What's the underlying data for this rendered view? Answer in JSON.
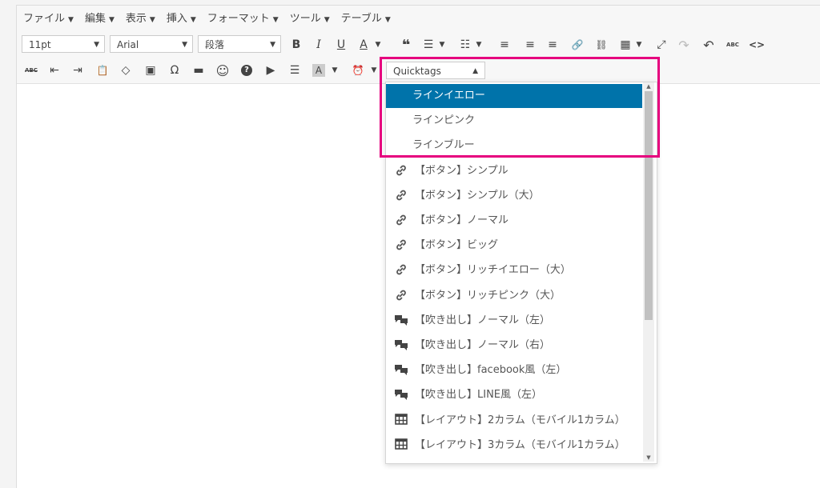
{
  "menubar": [
    {
      "label": "ファイル",
      "caret": "▼"
    },
    {
      "label": "編集",
      "caret": "▼"
    },
    {
      "label": "表示",
      "caret": "▼"
    },
    {
      "label": "挿入",
      "caret": "▼"
    },
    {
      "label": "フォーマット",
      "caret": "▼"
    },
    {
      "label": "ツール",
      "caret": "▼"
    },
    {
      "label": "テーブル",
      "caret": "▼"
    }
  ],
  "toolbar": {
    "font_size": "11pt",
    "font_family": "Arial",
    "format": "段落",
    "bold": "B",
    "italic": "I",
    "underline": "U",
    "text_color": "A",
    "blockquote": "❝",
    "bullet_list": "☰",
    "numbered_list": "☷",
    "align_left": "≡",
    "align_center": "≡",
    "align_right": "≡",
    "link": "🔗",
    "unlink": "⛓",
    "table": "▦",
    "fullscreen": "⤢",
    "redo": "↷",
    "undo": "↶",
    "spellcheck": "ABC",
    "code": "<>",
    "strikethrough": "ABC",
    "outdent": "⇤",
    "indent": "⇥",
    "paste": "📋",
    "clear_format": "◇",
    "image": "▣",
    "omega": "Ω",
    "hr": "▬",
    "emoji": "☺",
    "help": "?",
    "media": "▶",
    "justify": "☰",
    "bg_color": "A",
    "clock": "⏰",
    "dropdown_caret": "▼"
  },
  "quicktags": {
    "label": "Quicktags",
    "caret": "▲"
  },
  "dropdown": {
    "items": [
      {
        "label": "ラインイエロー",
        "icon": "",
        "selected": true
      },
      {
        "label": "ラインピンク",
        "icon": ""
      },
      {
        "label": "ラインブルー",
        "icon": ""
      },
      {
        "label": "【ボタン】シンプル",
        "icon": "link-icon"
      },
      {
        "label": "【ボタン】シンプル（大）",
        "icon": "link-icon"
      },
      {
        "label": "【ボタン】ノーマル",
        "icon": "link-icon"
      },
      {
        "label": "【ボタン】ビッグ",
        "icon": "link-icon"
      },
      {
        "label": "【ボタン】リッチイエロー（大）",
        "icon": "link-icon"
      },
      {
        "label": "【ボタン】リッチピンク（大）",
        "icon": "link-icon"
      },
      {
        "label": "【吹き出し】ノーマル（左）",
        "icon": "comments-icon"
      },
      {
        "label": "【吹き出し】ノーマル（右）",
        "icon": "comments-icon"
      },
      {
        "label": "【吹き出し】facebook風（左）",
        "icon": "comments-icon"
      },
      {
        "label": "【吹き出し】LINE風（左）",
        "icon": "comments-icon"
      },
      {
        "label": "【レイアウト】2カラム（モバイル1カラム）",
        "icon": "layout-icon"
      },
      {
        "label": "【レイアウト】3カラム（モバイル1カラム）",
        "icon": "layout-icon"
      }
    ]
  },
  "colors": {
    "selected": "#0073aa",
    "highlight": "#e6007e"
  }
}
